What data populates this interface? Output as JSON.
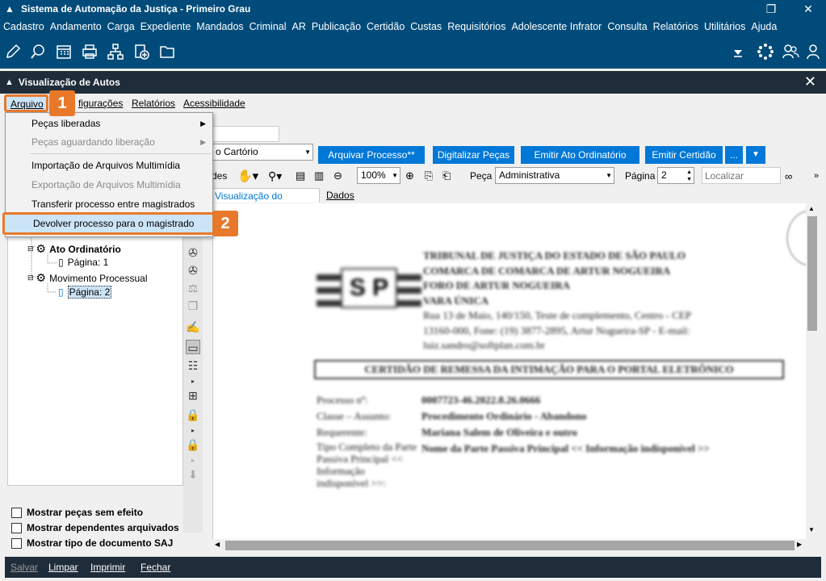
{
  "app": {
    "title": "Sistema de Automação da Justiça - Primeiro Grau",
    "menu": [
      "Cadastro",
      "Andamento",
      "Carga",
      "Expediente",
      "Mandados",
      "Criminal",
      "AR",
      "Publicação",
      "Certidão",
      "Custas",
      "Requisitórios",
      "Adolescente Infrator",
      "Consulta",
      "Relatórios",
      "Utilitários",
      "Ajuda"
    ],
    "toolbar_icons": [
      "edit-icon",
      "search-doc-icon",
      "calendar-icon",
      "printer-icon",
      "hierarchy-icon",
      "add-document-icon",
      "folder-icon"
    ],
    "right_icons": [
      "dropdown-arrow-icon",
      "spinner-icon",
      "users-icon",
      "user-icon"
    ]
  },
  "window": {
    "title": "Visualização de Autos",
    "menu": {
      "arquivo": "Arquivo",
      "configuracoes": "Configurações",
      "configuracoes_visible": "figurações",
      "relatorios": "Relatórios",
      "acessibilidade": "Acessibilidade"
    }
  },
  "dropdown": {
    "items": [
      {
        "label": "Peças liberadas",
        "submenu": true,
        "disabled": false
      },
      {
        "label": "Peças aguardando liberação",
        "submenu": true,
        "disabled": true
      },
      {
        "label": "Importação de Arquivos Multimídia",
        "disabled": false
      },
      {
        "label": "Exportação de Arquivos Multimídia",
        "disabled": true
      },
      {
        "label": "Transferir processo entre magistrados",
        "disabled": false
      },
      {
        "label": "Devolver processo para o magistrado",
        "disabled": false,
        "highlighted": true
      }
    ]
  },
  "badges": {
    "one": "1",
    "two": "2"
  },
  "tree": {
    "items": [
      {
        "label": "Ato Ordinatório",
        "bold": true
      },
      {
        "label": "Página: 1"
      },
      {
        "label": "Movimento Processual"
      },
      {
        "label": "Página: 2",
        "selected": true
      }
    ]
  },
  "checkboxes": [
    "Mostrar peças sem efeito",
    "Mostrar dependentes arquivados",
    "Mostrar tipo de documento SAJ"
  ],
  "actions": {
    "cartorio_select": "o Cartório",
    "buttons": [
      "Arquivar Processo**",
      "Digitalizar Peças",
      "Emitir Ato Ordinatório",
      "Emitir Certidão",
      "..."
    ]
  },
  "viewer_toolbar": {
    "des_label": "des",
    "zoom": "100%",
    "peca_label": "Peça",
    "peca_value": "Administrativa",
    "pagina_label": "Página",
    "pagina_value": "2",
    "search_placeholder": "Localizar"
  },
  "tabs": [
    "Visualização do Processo",
    "Dados do processo"
  ],
  "document": {
    "header_lines": [
      "TRIBUNAL DE JUSTIÇA DO ESTADO DE SÃO PAULO",
      "COMARCA DE COMARCA DE ARTUR NOGUEIRA",
      "FORO DE ARTUR NOGUEIRA",
      "VARA ÚNICA",
      "Rua 13 de Maio, 140/150, Teste de complemento, Centro - CEP",
      "13160-000, Fone: (19) 3877-2895, Artur Nogueira-SP - E-mail:",
      "luiz.sandro@softplan.com.br"
    ],
    "title": "CERTIDÃO DE REMESSA DA INTIMAÇÃO PARA O PORTAL ELETRÔNICO",
    "fields": [
      {
        "k": "Processo nº:",
        "v": "0007723-46.2022.8.26.0666"
      },
      {
        "k": "Classe – Assunto:",
        "v": "Procedimento Ordinário - Abandono"
      },
      {
        "k": "Requerente:",
        "v": "Mariana Salem de Oliveira e outro"
      },
      {
        "k": "Tipo Completo da Parte Passiva Principal << Informação indisponível >>:",
        "v": "Nome da Parte Passiva Principal << Informação indisponível >>"
      }
    ]
  },
  "bottom": [
    "Salvar",
    "Limpar",
    "Imprimir",
    "Fechar"
  ]
}
